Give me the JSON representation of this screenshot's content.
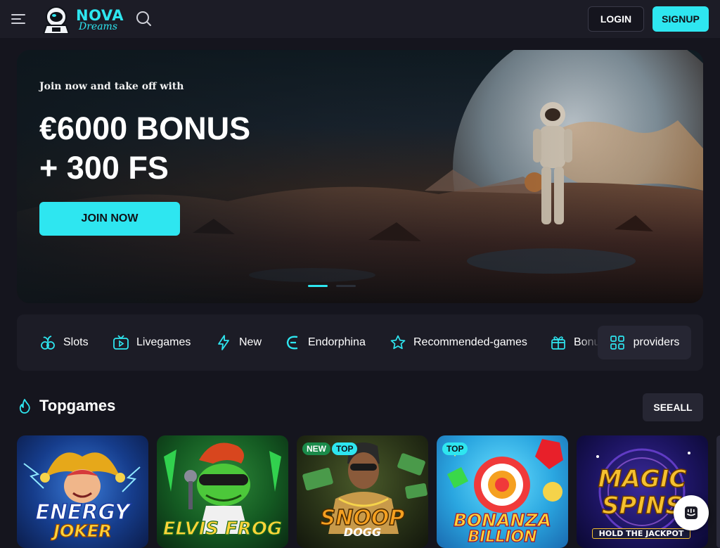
{
  "header": {
    "logo_line1": "NOVA",
    "logo_line2": "Dreams",
    "login_label": "LOGIN",
    "signup_label": "SIGNUP",
    "menu_icon": "hamburger-icon",
    "search_icon": "search-icon"
  },
  "hero": {
    "subtitle": "Join now and take off with",
    "title_line1": "€6000 BONUS",
    "title_line2": "+ 300 FS",
    "cta_label": "JOIN NOW",
    "slide_count": 2,
    "active_slide": 1
  },
  "categories": {
    "items": [
      {
        "label": "Slots",
        "icon": "slots-icon"
      },
      {
        "label": "Livegames",
        "icon": "tv-icon"
      },
      {
        "label": "New",
        "icon": "lightning-icon"
      },
      {
        "label": "Endorphina",
        "icon": "endorphina-icon"
      },
      {
        "label": "Recommended-games",
        "icon": "star-icon"
      },
      {
        "label": "Bonus",
        "icon": "gift-icon"
      }
    ],
    "providers_label": "providers",
    "providers_icon": "grid-icon"
  },
  "topgames": {
    "title": "Topgames",
    "title_icon": "flame-icon",
    "see_all_label": "SEEALL",
    "games": [
      {
        "name_line1": "ENERGY",
        "name_line2": "JOKER",
        "badges": []
      },
      {
        "name_line1": "ELVIS FROG",
        "name_line2": "",
        "badges": []
      },
      {
        "name_line1": "SNOOP",
        "name_line2": "DOGG",
        "badges": [
          "NEW",
          "TOP"
        ]
      },
      {
        "name_line1": "BONANZA",
        "name_line2": "BILLION",
        "badges": [
          "TOP"
        ]
      },
      {
        "name_line1": "MAGIC",
        "name_line2": "SPINS",
        "tagline": "HOLD THE JACKPOT",
        "badges": []
      }
    ]
  },
  "colors": {
    "accent": "#2ee6f0",
    "background": "#15151e",
    "panel": "#1c1c26"
  },
  "chat": {
    "icon": "chat-icon"
  }
}
